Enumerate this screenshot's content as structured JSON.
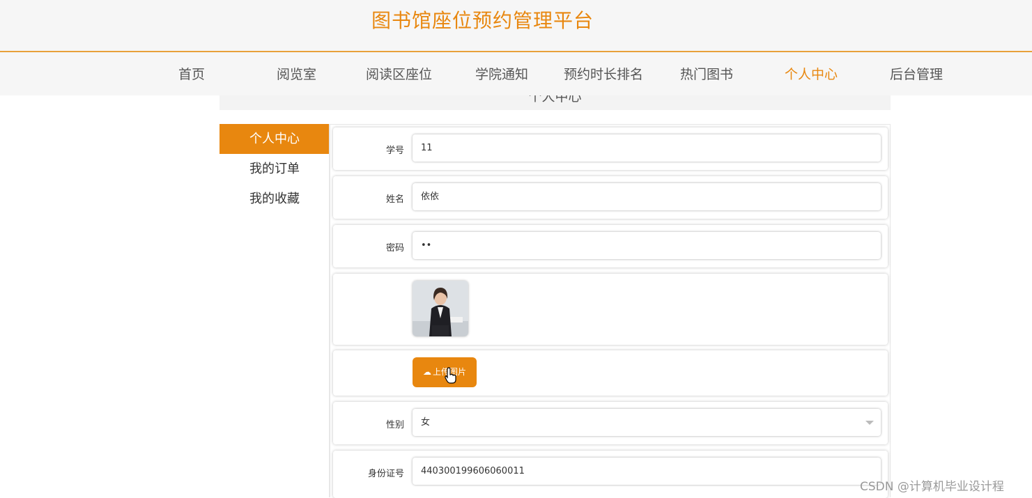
{
  "header": {
    "site_title": "图书馆座位预约管理平台"
  },
  "nav": [
    {
      "label": "首页"
    },
    {
      "label": "阅览室"
    },
    {
      "label": "阅读区座位"
    },
    {
      "label": "学院通知"
    },
    {
      "label": "预约时长排名"
    },
    {
      "label": "热门图书"
    },
    {
      "label": "个人中心",
      "active": true
    },
    {
      "label": "后台管理"
    }
  ],
  "section": {
    "title": "个人中心"
  },
  "sidebar": {
    "items": [
      {
        "label": "个人中心",
        "active": true
      },
      {
        "label": "我的订单"
      },
      {
        "label": "我的收藏"
      }
    ]
  },
  "form": {
    "student_id": {
      "label": "学号",
      "value": "11"
    },
    "name": {
      "label": "姓名",
      "value": "依依"
    },
    "password": {
      "label": "密码",
      "value": "••"
    },
    "upload_button": "上传图片",
    "gender": {
      "label": "性别",
      "value": "女"
    },
    "id_card": {
      "label": "身份证号",
      "value": "440300199606060011"
    }
  },
  "watermark": "CSDN @计算机毕业设计程",
  "colors": {
    "accent": "#e8870f",
    "nav_bg": "#f6f6f6"
  },
  "icons": {
    "upload": "cloud-upload-icon",
    "cursor": "hand-pointer-icon",
    "dropdown": "caret-down-icon"
  }
}
